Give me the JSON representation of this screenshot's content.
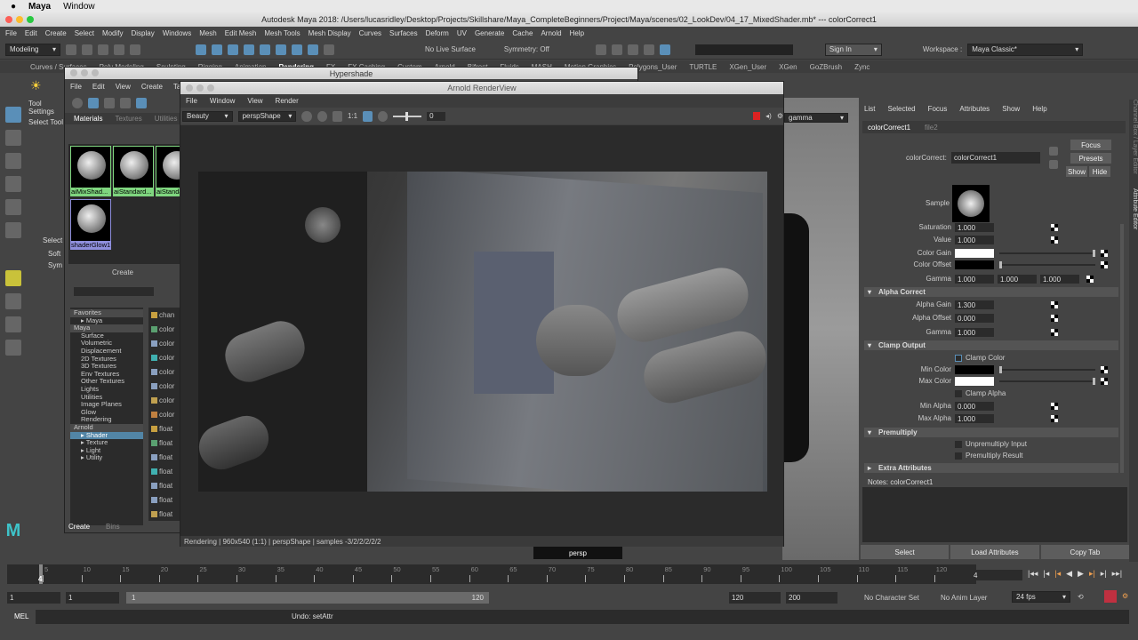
{
  "os_menu": {
    "app": "Maya",
    "items": [
      "Window"
    ]
  },
  "window_title": "Autodesk Maya 2018: /Users/lucasridley/Desktop/Projects/Skillshare/Maya_CompleteBeginners/Project/Maya/scenes/02_LookDev/04_17_MixedShader.mb*  ---  colorCorrect1",
  "main_menu": [
    "File",
    "Edit",
    "Create",
    "Select",
    "Modify",
    "Display",
    "Windows",
    "Mesh",
    "Edit Mesh",
    "Mesh Tools",
    "Mesh Display",
    "Curves",
    "Surfaces",
    "Deform",
    "UV",
    "Generate",
    "Cache",
    "Arnold",
    "Help"
  ],
  "status_line": {
    "menu_set": "Modeling",
    "live_surface": "No Live Surface",
    "symmetry": "Symmetry: Off",
    "sign_in": "Sign In",
    "workspace_label": "Workspace :",
    "workspace": "Maya Classic*"
  },
  "shelf_tabs": [
    "Curves / Surfaces",
    "Poly Modeling",
    "Sculpting",
    "Rigging",
    "Animation",
    "Rendering",
    "FX",
    "FX Caching",
    "Custom",
    "Arnold",
    "Bifrost",
    "Fluids",
    "MASH",
    "Motion Graphics",
    "Polygons_User",
    "TURTLE",
    "XGen_User",
    "XGen",
    "GoZBrush",
    "Zync"
  ],
  "left_panel": {
    "tool_settings": "Tool Settings",
    "select_tool": "Select Tool",
    "select": "Select",
    "items": [
      "Soft",
      "Sym"
    ]
  },
  "hypershade": {
    "title": "Hypershade",
    "menu": [
      "File",
      "Edit",
      "View",
      "Create",
      "Tabs"
    ],
    "tabs": [
      "Materials",
      "Textures",
      "Utilities"
    ],
    "swatches": [
      {
        "label": "aiMixShad...",
        "color": "#7fd67f"
      },
      {
        "label": "aiStandard...",
        "color": "#7fd67f"
      },
      {
        "label": "aiStanda...",
        "color": "#7fd67f"
      },
      {
        "label": "shaderGlow1",
        "color": "#8e8edc"
      }
    ],
    "create_label": "Create",
    "tree": [
      {
        "label": "Favorites",
        "type": "h"
      },
      {
        "label": "▸ Maya",
        "type": "c"
      },
      {
        "label": "Maya",
        "type": "h"
      },
      {
        "label": "Surface"
      },
      {
        "label": "Volumetric"
      },
      {
        "label": "Displacement"
      },
      {
        "label": "2D Textures"
      },
      {
        "label": "3D Textures"
      },
      {
        "label": "Env Textures"
      },
      {
        "label": "Other Textures"
      },
      {
        "label": "Lights"
      },
      {
        "label": "Utilities"
      },
      {
        "label": "Image Planes"
      },
      {
        "label": "Glow"
      },
      {
        "label": "Rendering"
      },
      {
        "label": "Arnold",
        "type": "h"
      },
      {
        "label": "▸ Shader",
        "type": "sel"
      },
      {
        "label": "▸ Texture"
      },
      {
        "label": "▸ Light"
      },
      {
        "label": "▸ Utility"
      }
    ],
    "nodes": [
      "chan",
      "color",
      "color",
      "color",
      "color",
      "color",
      "color",
      "color",
      "float",
      "float",
      "float",
      "float",
      "float",
      "float",
      "float"
    ],
    "bottom_tabs": [
      "Create",
      "Bins"
    ]
  },
  "renderview": {
    "title": "Arnold RenderView",
    "menu": [
      "File",
      "Window",
      "View",
      "Render"
    ],
    "aov": "Beauty",
    "camera": "perspShape",
    "ratio": "1:1",
    "exposure": "0",
    "status": "Rendering | 960x540 (1:1) | perspShape  | samples -3/2/2/2/2/2"
  },
  "viewport": {
    "gamma_dropdown": "gamma",
    "camera_label": "persp"
  },
  "attribute_editor": {
    "menu": [
      "List",
      "Selected",
      "Focus",
      "Attributes",
      "Show",
      "Help"
    ],
    "tabs": [
      "colorCorrect1",
      "file2"
    ],
    "node_label": "colorCorrect:",
    "node_name": "colorCorrect1",
    "buttons": {
      "focus": "Focus",
      "presets": "Presets",
      "show": "Show",
      "hide": "Hide"
    },
    "sample_label": "Sample",
    "attrs_top": [
      {
        "label": "Saturation",
        "value": "1.000"
      },
      {
        "label": "Value",
        "value": "1.000"
      }
    ],
    "color_gain": {
      "label": "Color Gain",
      "color": "#ffffff"
    },
    "color_offset": {
      "label": "Color Offset",
      "color": "#000000"
    },
    "gamma": {
      "label": "Gamma",
      "values": [
        "1.000",
        "1.000",
        "1.000"
      ]
    },
    "alpha_correct": {
      "title": "Alpha Correct",
      "attrs": [
        {
          "label": "Alpha Gain",
          "value": "1.300"
        },
        {
          "label": "Alpha Offset",
          "value": "0.000"
        },
        {
          "label": "Gamma",
          "value": "1.000"
        }
      ]
    },
    "clamp_output": {
      "title": "Clamp Output",
      "clamp_color": "Clamp Color",
      "min_color": "Min Color",
      "max_color": "Max Color",
      "clamp_alpha": "Clamp Alpha",
      "min_alpha": {
        "label": "Min Alpha",
        "value": "0.000"
      },
      "max_alpha": {
        "label": "Max Alpha",
        "value": "1.000"
      }
    },
    "premultiply": {
      "title": "Premultiply",
      "unpremultiply": "Unpremultiply Input",
      "premultiply_result": "Premultiply Result"
    },
    "extra": "Extra Attributes",
    "notes": "Notes:  colorCorrect1",
    "bottom_buttons": [
      "Select",
      "Load Attributes",
      "Copy Tab"
    ],
    "side_tabs": [
      "Channel Box / Layer Editor",
      "Attribute Editor"
    ]
  },
  "timeline": {
    "ticks": [
      "5",
      "10",
      "15",
      "20",
      "25",
      "30",
      "35",
      "40",
      "45",
      "50",
      "55",
      "60",
      "65",
      "70",
      "75",
      "80",
      "85",
      "90",
      "95",
      "100",
      "105",
      "110",
      "115",
      "120"
    ],
    "current_frame": "4",
    "current_field": "4"
  },
  "range": {
    "start": "1",
    "playback_start": "1",
    "slider_start": "1",
    "slider_end": "120",
    "end": "120",
    "anim_end": "200",
    "character_set": "No Character Set",
    "anim_layer": "No Anim Layer",
    "fps": "24 fps"
  },
  "command": {
    "lang": "MEL",
    "result": "Undo: setAttr"
  }
}
